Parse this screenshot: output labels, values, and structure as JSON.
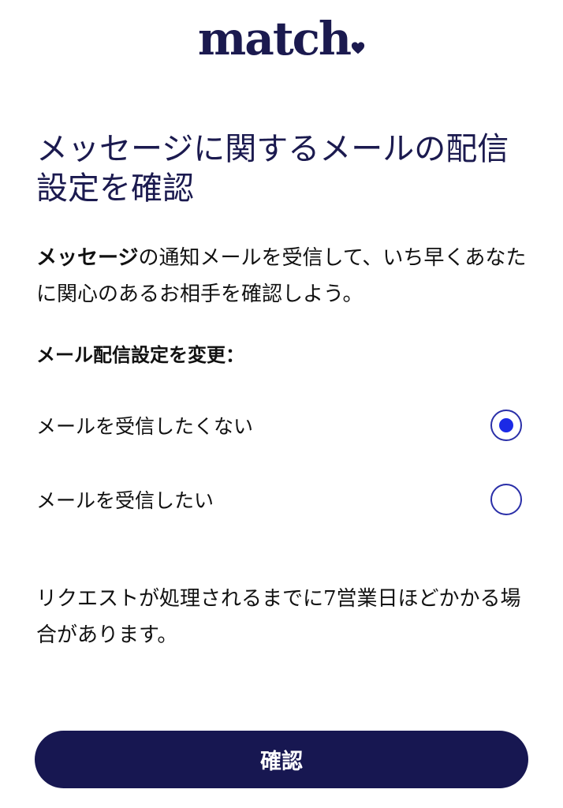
{
  "brand": {
    "logo_text": "match",
    "logo_icon": "heart-icon",
    "color": "#1b1a4f"
  },
  "title": "メッセージに関するメールの配信設定を確認",
  "description": {
    "bold": "メッセージ",
    "rest": "の通知メールを受信して、いち早くあなたに関心のあるお相手を確認しよう。"
  },
  "settings": {
    "label": "メール配信設定を変更：",
    "options": [
      {
        "label": "メールを受信したくない",
        "selected": true
      },
      {
        "label": "メールを受信したい",
        "selected": false
      }
    ],
    "accent_color": "#1b2ae6"
  },
  "note": "リクエストが処理されるまでに7営業日ほどかかる場合があります。",
  "confirm_button": {
    "label": "確認",
    "color": "#171751"
  }
}
